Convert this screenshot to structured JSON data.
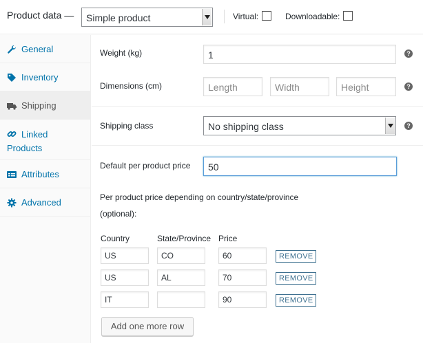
{
  "header": {
    "title": "Product data —",
    "product_type": "Simple product",
    "virtual_label": "Virtual:",
    "virtual_checked": false,
    "downloadable_label": "Downloadable:",
    "downloadable_checked": false
  },
  "sidebar": {
    "items": [
      {
        "label": "General",
        "icon": "wrench-icon",
        "active": false
      },
      {
        "label": "Inventory",
        "icon": "tag-icon",
        "active": false
      },
      {
        "label": "Shipping",
        "icon": "truck-icon",
        "active": true
      },
      {
        "label": "Linked",
        "label2": "Products",
        "icon": "link-icon",
        "active": false
      },
      {
        "label": "Attributes",
        "icon": "list-icon",
        "active": false
      },
      {
        "label": "Advanced",
        "icon": "gear-icon",
        "active": false
      }
    ]
  },
  "shipping": {
    "weight_label": "Weight (kg)",
    "weight_value": "1",
    "dimensions_label": "Dimensions (cm)",
    "length_placeholder": "Length",
    "width_placeholder": "Width",
    "height_placeholder": "Height",
    "shipping_class_label": "Shipping class",
    "shipping_class_value": "No shipping class",
    "default_price_label": "Default per product price",
    "default_price_value": "50",
    "country_price_line1": "Per product price depending on country/state/province",
    "country_price_line2": "(optional):",
    "columns": [
      "Country",
      "State/Province",
      "Price"
    ],
    "rows": [
      {
        "country": "US",
        "state": "CO",
        "price": "60",
        "remove": "REMOVE"
      },
      {
        "country": "US",
        "state": "AL",
        "price": "70",
        "remove": "REMOVE"
      },
      {
        "country": "IT",
        "state": "",
        "price": "90",
        "remove": "REMOVE"
      }
    ],
    "add_row_label": "Add one more row"
  },
  "colors": {
    "link": "#0073aa",
    "active_tab_bg": "#eeeeee",
    "focus_border": "#5b9dd9",
    "remove_button": "#3c6f8f"
  }
}
